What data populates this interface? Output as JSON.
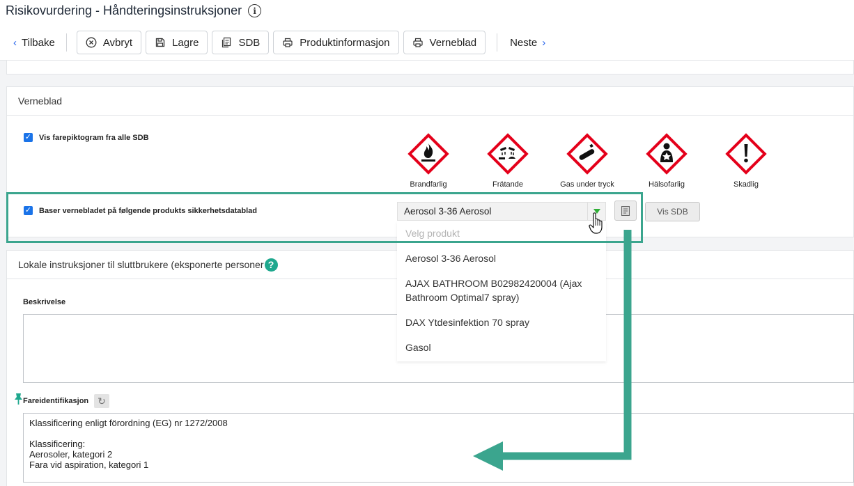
{
  "header": {
    "title": "Risikovurdering - Håndteringsinstruksjoner",
    "back_label": "Tilbake",
    "next_label": "Neste",
    "buttons": [
      "Avbryt",
      "Lagre",
      "SDB",
      "Produktinformasjon",
      "Verneblad"
    ]
  },
  "verneblad": {
    "title": "Verneblad",
    "show_pictograms_label": "Vis farepiktogram fra alle SDB",
    "show_pictograms_checked": true,
    "pictograms": [
      "Brandfarlig",
      "Frätande",
      "Gas under tryck",
      "Hälsofarlig",
      "Skadlig"
    ],
    "base_label": "Baser vernebladet på følgende produkts sikkerhetsdatablad",
    "base_checked": true,
    "selected_product": "Aerosol 3-36 Aerosol",
    "vis_sdb_label": "Vis SDB"
  },
  "dropdown": {
    "placeholder": "Velg produkt",
    "options": [
      "Aerosol 3-36 Aerosol",
      "AJAX BATHROOM B02982420004 (Ajax Bathroom Optimal7 spray)",
      "DAX Ytdesinfektion 70 spray",
      "Gasol"
    ]
  },
  "lokale": {
    "title": "Lokale instruksjoner til sluttbrukere (eksponerte personer",
    "beskrivelse_label": "Beskrivelse",
    "beskrivelse_value": "",
    "fareid_label": "Fareidentifikasjon",
    "fareid_text": "Klassificering enligt förordning (EG) nr 1272/2008\n\nKlassificering:\nAerosoler, kategori 2\nFara vid aspiration, kategori 1"
  },
  "colors": {
    "accent": "#3ba58e",
    "checkbox": "#1a73e8",
    "ghs_red": "#e4001a"
  }
}
